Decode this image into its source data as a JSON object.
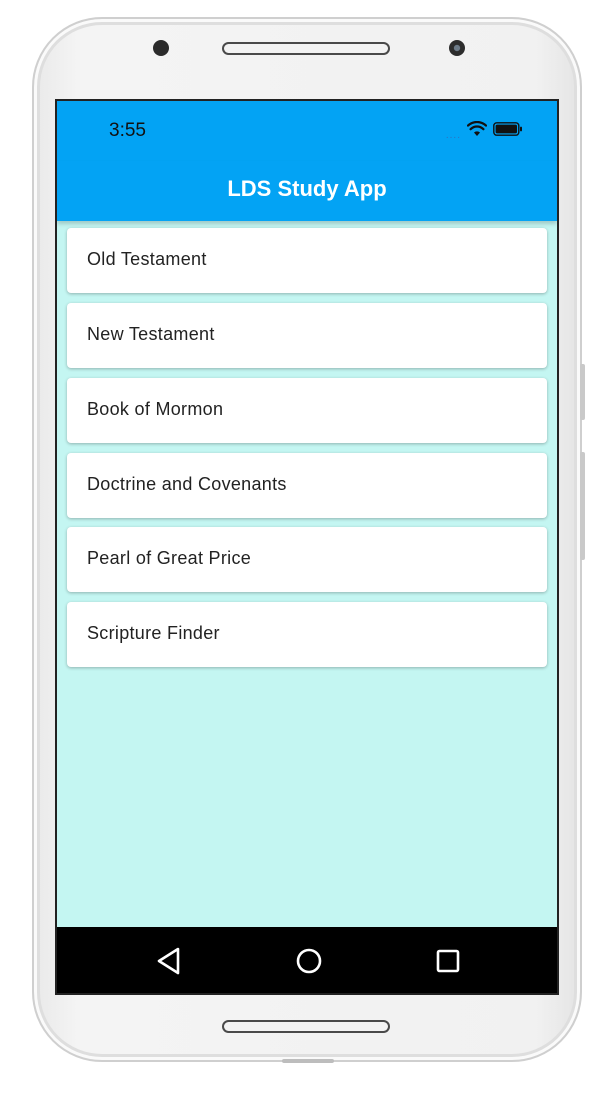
{
  "status_bar": {
    "time": "3:55",
    "signal": "....",
    "icons": [
      "wifi-icon",
      "battery-icon"
    ]
  },
  "app_bar": {
    "title": "LDS Study App",
    "color": "#03a3f4"
  },
  "menu": {
    "items": [
      {
        "label": "Old Testament"
      },
      {
        "label": "New Testament"
      },
      {
        "label": "Book of Mormon"
      },
      {
        "label": "Doctrine and Covenants"
      },
      {
        "label": "Pearl of Great Price"
      },
      {
        "label": "Scripture Finder"
      }
    ],
    "background_color": "#c4f6f2"
  },
  "nav_bar": {
    "buttons": [
      "back-icon",
      "home-icon",
      "recent-apps-icon"
    ]
  }
}
